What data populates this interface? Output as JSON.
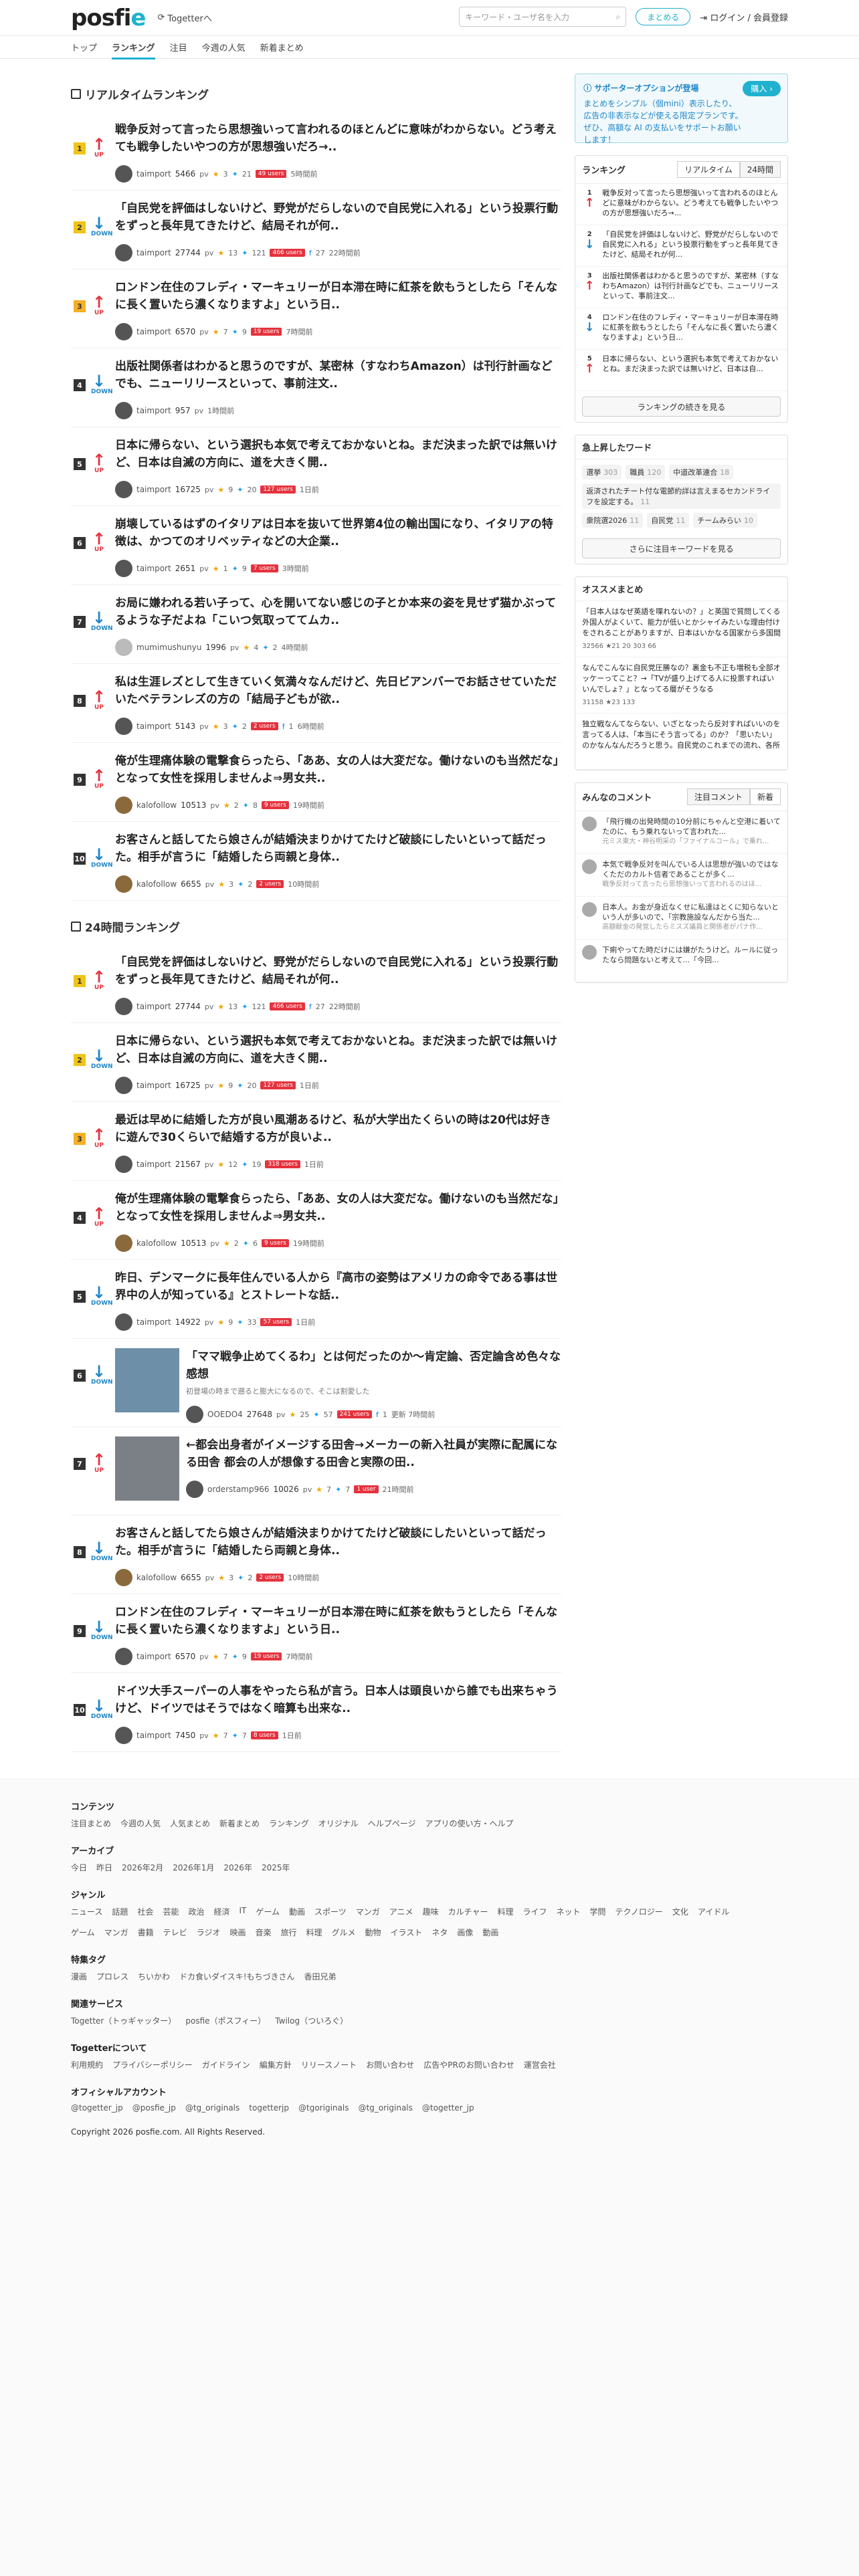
{
  "header": {
    "logo": "posfie",
    "togetter": "Togetterへ",
    "search_placeholder": "キーワード・ユーザ名を入力",
    "matome_button": "まとめる",
    "login": "ログイン / 会員登録"
  },
  "nav": [
    "トップ",
    "ランキング",
    "注目",
    "今週の人気",
    "新着まとめ"
  ],
  "realtime": {
    "title": "リアルタイムランキング",
    "items": [
      {
        "rank": "1",
        "dir": "UP",
        "title": "戦争反対って言ったら思想強いって言われるのほとんどに意味がわからない。どう考えても戦争したいやつの方が思想強いだろ→..",
        "user": "taimport",
        "pv": "5466",
        "stars": "3",
        "tw": "21",
        "users": "49 users",
        "ago": "5時間前"
      },
      {
        "rank": "2",
        "dir": "DOWN",
        "title": "「自民党を評価はしないけど、野党がだらしないので自民党に入れる」という投票行動をずっと長年見てきたけど、結局それが何..",
        "user": "taimport",
        "pv": "27744",
        "stars": "13",
        "tw": "121",
        "users": "466 users",
        "fb": "27",
        "ago": "22時間前"
      },
      {
        "rank": "3",
        "dir": "UP",
        "title": "ロンドン在住のフレディ・マーキュリーが日本滞在時に紅茶を飲もうとしたら「そんなに長く置いたら濃くなりますよ」という日..",
        "user": "taimport",
        "pv": "6570",
        "stars": "7",
        "tw": "9",
        "users": "19 users",
        "ago": "7時間前"
      },
      {
        "rank": "4",
        "dir": "DOWN",
        "title": "出版社関係者はわかると思うのですが、某密林（すなわちAmazon）は刊行計画などでも、ニューリリースといって、事前注文..",
        "user": "taimport",
        "pv": "957",
        "stars": "",
        "tw": "",
        "users": "",
        "ago": "1時間前"
      },
      {
        "rank": "5",
        "dir": "UP",
        "title": "日本に帰らない、という選択も本気で考えておかないとね。まだ決まった訳では無いけど、日本は自滅の方向に、道を大きく開..",
        "user": "taimport",
        "pv": "16725",
        "stars": "9",
        "tw": "20",
        "users": "127 users",
        "ago": "1日前"
      },
      {
        "rank": "6",
        "dir": "UP",
        "title": "崩壊しているはずのイタリアは日本を抜いて世界第4位の輸出国になり、イタリアの特徴は、かつてのオリベッティなどの大企業..",
        "user": "taimport",
        "pv": "2651",
        "stars": "1",
        "tw": "9",
        "users": "7 users",
        "ago": "3時間前"
      },
      {
        "rank": "7",
        "dir": "DOWN",
        "title": "お局に嫌われる若い子って、心を開いてない感じの子とか本来の姿を見せず猫かぶってるような子だよね「こいつ気取っててムカ..",
        "user": "mumimushunyu",
        "pv": "1996",
        "stars": "4",
        "tw": "2",
        "users": "",
        "ago": "4時間前"
      },
      {
        "rank": "8",
        "dir": "UP",
        "title": "私は生涯レズとして生きていく気満々なんだけど、先日ビアンバーでお話させていただいたベテランレズの方の「結局子どもが欲..",
        "user": "taimport",
        "pv": "5143",
        "stars": "3",
        "tw": "2",
        "users": "2 users",
        "fb": "1",
        "ago": "6時間前"
      },
      {
        "rank": "9",
        "dir": "UP",
        "title": "俺が生理痛体験の電撃食らったら、「ああ、女の人は大変だな。働けないのも当然だな」となって女性を採用しませんよ⇒男女共..",
        "user": "kalofollow",
        "pv": "10513",
        "stars": "2",
        "tw": "8",
        "users": "9 users",
        "ago": "19時間前"
      },
      {
        "rank": "10",
        "dir": "DOWN",
        "title": "お客さんと話してたら娘さんが結婚決まりかけてたけど破談にしたいといって話だった。相手が言うに「結婚したら両親と身体..",
        "user": "kalofollow",
        "pv": "6655",
        "stars": "3",
        "tw": "2",
        "users": "2 users",
        "ago": "10時間前"
      }
    ]
  },
  "daily": {
    "title": "24時間ランキング",
    "items": [
      {
        "rank": "1",
        "dir": "UP",
        "title": "「自民党を評価はしないけど、野党がだらしないので自民党に入れる」という投票行動をずっと長年見てきたけど、結局それが何..",
        "user": "taimport",
        "pv": "27744",
        "stars": "13",
        "tw": "121",
        "users": "466 users",
        "fb": "27",
        "ago": "22時間前"
      },
      {
        "rank": "2",
        "dir": "DOWN",
        "title": "日本に帰らない、という選択も本気で考えておかないとね。まだ決まった訳では無いけど、日本は自滅の方向に、道を大きく開..",
        "user": "taimport",
        "pv": "16725",
        "stars": "9",
        "tw": "20",
        "users": "127 users",
        "ago": "1日前"
      },
      {
        "rank": "3",
        "dir": "UP",
        "title": "最近は早めに結婚した方が良い風潮あるけど、私が大学出たくらいの時は20代は好きに遊んで30くらいで結婚する方が良いよ..",
        "user": "taimport",
        "pv": "21567",
        "stars": "12",
        "tw": "19",
        "users": "318 users",
        "ago": "1日前"
      },
      {
        "rank": "4",
        "dir": "UP",
        "title": "俺が生理痛体験の電撃食らったら、「ああ、女の人は大変だな。働けないのも当然だな」となって女性を採用しませんよ⇒男女共..",
        "user": "kalofollow",
        "pv": "10513",
        "stars": "2",
        "tw": "6",
        "users": "9 users",
        "ago": "19時間前"
      },
      {
        "rank": "5",
        "dir": "DOWN",
        "title": "昨日、デンマークに長年住んでいる人から『高市の姿勢はアメリカの命令である事は世界中の人が知っている』とストレートな話..",
        "user": "taimport",
        "pv": "14922",
        "stars": "9",
        "tw": "33",
        "users": "57 users",
        "ago": "1日前"
      },
      {
        "rank": "6",
        "dir": "DOWN",
        "title": "「ママ戦争止めてくるわ」とは何だったのか〜肯定論、否定論含め色々な感想",
        "sub": "初登場の時まで遡ると膨大になるので、そこは割愛した",
        "user": "OOEDO4",
        "pv": "27648",
        "stars": "25",
        "tw": "57",
        "users": "241 users",
        "fb": "1",
        "ago": "更新 7時間前",
        "thumb": true
      },
      {
        "rank": "7",
        "dir": "UP",
        "title": "←都会出身者がイメージする田舎→メーカーの新入社員が実際に配属になる田舎 都会の人が想像する田舎と実際の田..",
        "user": "orderstamp966",
        "pv": "10026",
        "stars": "7",
        "tw": "7",
        "users": "1 user",
        "ago": "21時間前",
        "thumb": true
      },
      {
        "rank": "8",
        "dir": "DOWN",
        "title": "お客さんと話してたら娘さんが結婚決まりかけてたけど破談にしたいといって話だった。相手が言うに「結婚したら両親と身体..",
        "user": "kalofollow",
        "pv": "6655",
        "stars": "3",
        "tw": "2",
        "users": "2 users",
        "ago": "10時間前"
      },
      {
        "rank": "9",
        "dir": "DOWN",
        "title": "ロンドン在住のフレディ・マーキュリーが日本滞在時に紅茶を飲もうとしたら「そんなに長く置いたら濃くなりますよ」という日..",
        "user": "taimport",
        "pv": "6570",
        "stars": "7",
        "tw": "9",
        "users": "19 users",
        "ago": "7時間前"
      },
      {
        "rank": "10",
        "dir": "DOWN",
        "title": "ドイツ大手スーパーの人事をやったら私が言う。日本人は頭良いから誰でも出来ちゃうけど、ドイツではそうではなく暗算も出来な..",
        "user": "taimport",
        "pv": "7450",
        "stars": "7",
        "tw": "7",
        "users": "8 users",
        "ago": "1日前"
      }
    ]
  },
  "side": {
    "support_title": "サポーターオプションが登場",
    "support_btn": "購入 ›",
    "support_desc": "まとめをシンプル（個mini）表示したり、広告の非表示などが使える限定プランです。ぜひ、高額な AI の支払いをサポートお願いします！",
    "ranking_title": "ランキング",
    "ranking_tabs": [
      "リアルタイム",
      "24時間"
    ],
    "ranking_items": [
      {
        "rank": "1",
        "dir": "UP",
        "text": "戦争反対って言ったら思想強いって言われるのほとんどに意味がわからない。どう考えても戦争したいやつの方が思想強いだろ→..."
      },
      {
        "rank": "2",
        "dir": "DOWN",
        "text": "「自民党を評価はしないけど、野党がだらしないので自民党に入れる」という投票行動をずっと長年見てきたけど、結局それが何..."
      },
      {
        "rank": "3",
        "dir": "UP",
        "text": "出版社関係者はわかると思うのですが、某密林（すなわちAmazon）は刊行計画などでも、ニューリリースといって、事前注文..."
      },
      {
        "rank": "4",
        "dir": "DOWN",
        "text": "ロンドン在住のフレディ・マーキュリーが日本滞在時に紅茶を飲もうとしたら「そんなに長く置いたら濃くなりますよ」という日..."
      },
      {
        "rank": "5",
        "dir": "UP",
        "text": "日本に帰らない、という選択も本気で考えておかないとね。まだ決まった訳では無いけど、日本は自..."
      }
    ],
    "ranking_more": "ランキングの続きを見る",
    "kw_title": "急上昇したワード",
    "keywords": [
      {
        "w": "選挙",
        "n": "303"
      },
      {
        "w": "職員",
        "n": "120"
      },
      {
        "w": "中道改革連合",
        "n": "18"
      },
      {
        "w": "返済されたチート付な電節約詳は言えまるセカンドライフを設定する。",
        "n": "11"
      },
      {
        "w": "衆院選2026",
        "n": "11"
      },
      {
        "w": "自民党",
        "n": "11"
      },
      {
        "w": "チームみらい",
        "n": "10"
      }
    ],
    "kw_more": "さらに注目キーワードを見る",
    "osusume_title": "オススメまとめ",
    "osusume": [
      {
        "t": "「日本人はなぜ英語を喋れないの？」と英国で質問してくる外国人がよくいて、能力が低いとかシャイみたいな理由付けをされることがありますが、日本はいかなる国家から多国間地域性を受けない所領かつ経済大国であり、日本語だけで完結する高度な経済、社会を維持できたという話",
        "m": "32566 ★21 20 303 66"
      },
      {
        "t": "なんでこんなに自民党圧勝なの？裏金も不正も増税も全部オッケーってこと？→「TVが盛り上げてる人に投票すればいいんでしょ？」となってる層がそうなる",
        "m": "31158 ★23 133"
      },
      {
        "t": "独立戦なんてならない、いざとなったら反対すればいいのを言ってる人は、「本当にそう言ってる」のか？「思いたい」のかなんなんだろうと思う。自民党のこれまでの流れ、各所での発言、あらゆることを考えたら「日本は大丈夫」なんてとても思えない状況ではないのかと",
        "m": ""
      }
    ],
    "comments_title": "みんなのコメント",
    "comments_tabs": [
      "注目コメント",
      "新着"
    ],
    "comments": [
      {
        "t": "「飛行機の出発時間の10分前にちゃんと空港に着いてたのに、もう乗れないって言われた...",
        "from": "元ミス東大・神谷明采の「ファイナルコール」で乗れ...",
        "n": "32"
      },
      {
        "t": "本気で戦争反対を叫んでいる人は思想が強いのではなくただのカルト信者であることが多く...",
        "from": "戦争反対って言ったら思想強いって言われるのはほ...",
        "n": "5"
      },
      {
        "t": "日本人。お金が身近なくせに私達はとくに知らないという人が多いので、「宗教施設なんだから当た...",
        "from": "高額献金の発覚したらミスズ議員と関係者がパナ作...",
        "n": "49"
      },
      {
        "t": "下痢やってた時だけには嫌がたうけど。ルールに従ったなら問題ないと考えて...「今回...",
        "from": "",
        "n": ""
      }
    ]
  },
  "footer": {
    "contents_title": "コンテンツ",
    "contents": [
      "注目まとめ",
      "今週の人気",
      "人気まとめ",
      "新着まとめ",
      "ランキング",
      "オリジナル",
      "ヘルプページ",
      "アプリの使い方・ヘルプ"
    ],
    "archive_title": "アーカイブ",
    "archive": [
      "今日",
      "昨日",
      "2026年2月",
      "2026年1月",
      "2026年",
      "2025年"
    ],
    "genre_title": "ジャンル",
    "genre": [
      "ニュース",
      "話題",
      "社会",
      "芸能",
      "政治",
      "経済",
      "IT",
      "ゲーム",
      "動画",
      "スポーツ",
      "マンガ",
      "アニメ",
      "趣味",
      "カルチャー",
      "料理",
      "ライフ",
      "ネット",
      "学問",
      "テクノロジー",
      "文化",
      "アイドル",
      "ゲーム",
      "マンガ",
      "書籍",
      "テレビ",
      "ラジオ",
      "映画",
      "音楽",
      "旅行",
      "料理",
      "グルメ",
      "動物",
      "イラスト",
      "ネタ",
      "画像",
      "動画"
    ],
    "tag_title": "特集タグ",
    "tags": [
      "漫画",
      "プロレス",
      "ちいかわ",
      "ドカ食いダイスキ!もちづきさん",
      "香田兄弟"
    ],
    "related_title": "関連サービス",
    "related": [
      "Togetter（トゥギャッター）",
      "posfie（ポスフィー）",
      "Twilog（ついろぐ）"
    ],
    "about_title": "Togetterについて",
    "about": [
      "利用規約",
      "プライバシーポリシー",
      "ガイドライン",
      "編集方針",
      "リリースノート",
      "お問い合わせ",
      "広告やPRのお問い合わせ",
      "運営会社"
    ],
    "official_title": "オフィシャルアカウント",
    "official": [
      "@togetter_jp",
      "@posfie_jp",
      "@tg_originals",
      "togetterjp",
      "@tgoriginals",
      "@tg_originals",
      "@togetter_jp"
    ],
    "copyright": "Copyright 2026 posfie.com. All Rights Reserved."
  }
}
